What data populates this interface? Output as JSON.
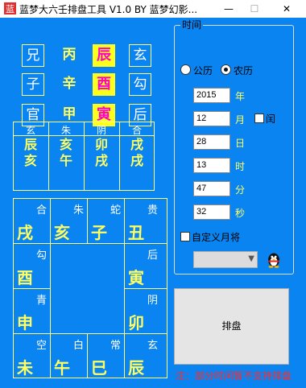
{
  "window": {
    "title": "蓝梦大六壬排盘工具 V1.0 BY 蓝梦幻影...",
    "minimize": "—",
    "maximize": "☐",
    "close": "✕"
  },
  "top_grid": [
    [
      "兄",
      "丙",
      "辰",
      "玄"
    ],
    [
      "子",
      "辛",
      "酉",
      "勾"
    ],
    [
      "官",
      "甲",
      "寅",
      "后"
    ]
  ],
  "small_grid": {
    "top": [
      "玄",
      "朱",
      "阴",
      "合"
    ],
    "bottom": [
      [
        "辰",
        "亥"
      ],
      [
        "亥",
        "午"
      ],
      [
        "卯",
        "戌"
      ],
      [
        "戌",
        "戌"
      ]
    ]
  },
  "big_grid": {
    "top_row": [
      {
        "label": "合",
        "branch": "戌"
      },
      {
        "label": "朱",
        "branch": "亥"
      },
      {
        "label": "蛇",
        "branch": "子"
      },
      {
        "label": "贵",
        "branch": "丑"
      }
    ],
    "left_col": [
      {
        "label": "勾",
        "branch": "酉"
      },
      {
        "label": "青",
        "branch": "申"
      }
    ],
    "right_col": [
      {
        "label": "后",
        "branch": "寅"
      },
      {
        "label": "阴",
        "branch": "卯"
      }
    ],
    "bottom_row": [
      {
        "label": "空",
        "branch": "未"
      },
      {
        "label": "白",
        "branch": "午"
      },
      {
        "label": "常",
        "branch": "巳"
      },
      {
        "label": "玄",
        "branch": "辰"
      }
    ]
  },
  "time_group": {
    "title": "时间",
    "calendar_solar": "公历",
    "calendar_lunar": "农历",
    "selected": "农历",
    "year": "2015",
    "year_unit": "年",
    "month": "12",
    "month_unit": "月",
    "leap_label": "闰",
    "leap_checked": false,
    "day": "28",
    "day_unit": "日",
    "hour": "13",
    "hour_unit": "时",
    "minute": "47",
    "minute_unit": "分",
    "second": "32",
    "second_unit": "秒",
    "custom_month_label": "自定义月将",
    "custom_month_checked": false,
    "month_general_value": ""
  },
  "actions": {
    "arrange_button": "排盘"
  },
  "note": "注：部分时间暂不支持排盘",
  "colors": {
    "background": "#0a84f0",
    "highlight": "#ffff1e",
    "highlight_text": "#ff00cc",
    "main_text": "#ffff60",
    "note": "#ff2a2a"
  }
}
